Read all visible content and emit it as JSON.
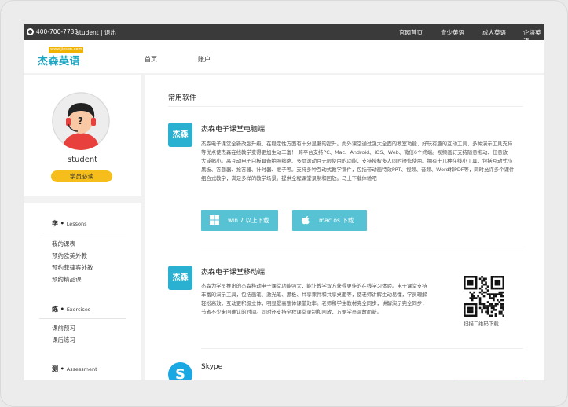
{
  "topbar": {
    "phone": "400-700-7733",
    "user_text": "student | 退出",
    "nav": [
      "官网首页",
      "青少英语",
      "成人英语",
      "企培英语"
    ]
  },
  "header": {
    "logo_url": "www.jiesen.com",
    "logo_text": "杰森英语",
    "nav": [
      "首页",
      "账户"
    ]
  },
  "profile": {
    "username": "student",
    "badge": "学员必读",
    "avatar_glyph": "?"
  },
  "sidebar": {
    "sections": [
      {
        "title": "学",
        "subtitle": "Lessons",
        "items": [
          "我的课表",
          "预约欧美外教",
          "预约菲律宾外教",
          "预约精品课"
        ]
      },
      {
        "title": "练",
        "subtitle": "Exercises",
        "items": [
          "课前预习",
          "课后练习"
        ]
      },
      {
        "title": "测",
        "subtitle": "Assessment",
        "items": []
      }
    ]
  },
  "main": {
    "heading": "常用软件",
    "apps": [
      {
        "icon_text": "杰森",
        "name": "杰森电子课堂电脑端",
        "lines": [
          "杰森电子课堂全新改版升级，在稳定性方面有十分显著的提升。此外课堂通过强大全面的教室功能、好玩有趣的互动工具、多种演示工具支持",
          "等优点使杰森在线教学变得更加生动丰富！ 跨平台支持PC、Mac、Android、iOS、Web、微信6个终端。视频画订支持随意拖动、任意放",
          "大或缩小。高互动电子白板具备拍照缩略、多页滚动且无限使用的功能，支持授权多人同时操作使用。拥有十几种在线小工具，包括互动式小",
          "黑板、答题器、抢答器、计时器、骰子等。支持多种互动式教学课件，包括带动画特效PPT、视频、音频、Word和PDF等，同时允许多个课件",
          "组合式教学，满足多样的教学场景。提供全程课堂录制和回放。马上下载体验吧"
        ],
        "buttons": [
          "win 7 以上下载",
          "mac os 下载"
        ]
      },
      {
        "icon_text": "杰森",
        "name": "杰森电子课堂移动端",
        "lines": [
          "杰森为学员推出的杰森移动电子课堂功能强大，能让教学双方获得更佳的在线学习体验。电子课堂支持",
          "丰富的演示工具，包括画笔、激光笔、黑板、共享课件和共享桌面等，使老师讲解生动易懂，学员理解",
          "轻松高效，互动更积极立体，明显提高整体课堂效率。老师和学生教材完全同步，讲解演示完全同步，",
          "节省不少来回确认的时间。同时还支持全程课堂录制和回放，方便学员温故而新。"
        ],
        "qr_caption": "扫描二维码下载"
      },
      {
        "icon_text": "S",
        "name": "Skype"
      }
    ]
  },
  "colors": {
    "topbar": "#3a3a3a",
    "accent": "#57c2d3",
    "badge": "#f5be1b",
    "app_icon": "#2ab0d0"
  }
}
